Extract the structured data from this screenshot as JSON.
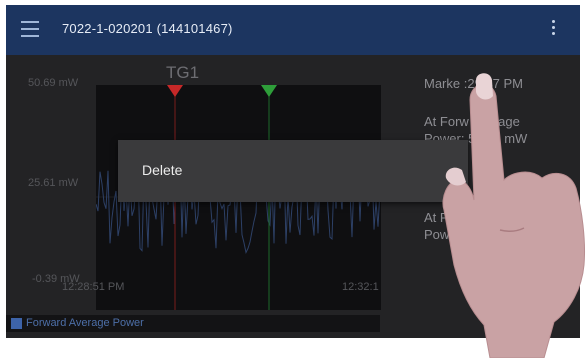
{
  "app_bar": {
    "title": "7022-1-020201 (144101467)",
    "menu_icon": "hamburger-menu-icon",
    "more_icon": "more-vertical-icon"
  },
  "chart": {
    "title": "TG1",
    "y_labels": [
      "50.69 mW",
      "25.61 mW",
      "-0.39 mW"
    ],
    "x_labels": [
      "12:28:51 PM",
      "12:32:1"
    ],
    "legend": "Forward Average Power",
    "legend_color": "#3d63a8",
    "marker_colors": [
      "#c62828",
      "#2e9e3a"
    ]
  },
  "side_panel": {
    "marker_line": "Marke     :29:47 PM",
    "fwd_line1": "At Forw     Average",
    "fwd_line2": "Power:      57.07 mW",
    "second_line1": "At Fo",
    "second_line2": "Powe"
  },
  "dialog": {
    "item": "Delete"
  },
  "chart_data": {
    "type": "line",
    "title": "TG1",
    "x_tick_labels": [
      "12:28:51 PM",
      "12:32:1"
    ],
    "y_tick_labels": [
      "50.69 mW",
      "25.61 mW",
      "-0.39 mW"
    ],
    "series": [
      {
        "name": "Forward Average Power"
      }
    ],
    "legend": "bottom-left"
  }
}
